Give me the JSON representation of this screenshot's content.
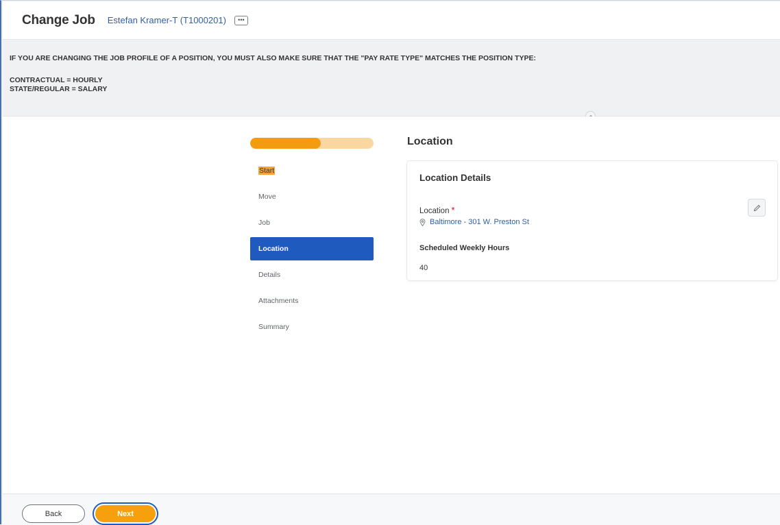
{
  "header": {
    "title": "Change Job",
    "worker": "Estefan Kramer-T (T1000201)",
    "related_actions_icon": "ellipsis-icon"
  },
  "notice": {
    "line1": "IF YOU ARE CHANGING THE JOB PROFILE OF A POSITION, YOU MUST ALSO MAKE SURE THAT THE \"PAY RATE TYPE\" MATCHES THE POSITION TYPE:",
    "line2": "CONTRACTUAL = HOURLY",
    "line3": "STATE/REGULAR = SALARY"
  },
  "progress": {
    "completed_fraction": 0.57
  },
  "steps": [
    {
      "label": "Start",
      "state": "highlighted"
    },
    {
      "label": "Move",
      "state": "default"
    },
    {
      "label": "Job",
      "state": "default"
    },
    {
      "label": "Location",
      "state": "active"
    },
    {
      "label": "Details",
      "state": "default"
    },
    {
      "label": "Attachments",
      "state": "default"
    },
    {
      "label": "Summary",
      "state": "default"
    }
  ],
  "section": {
    "title": "Location",
    "card_title": "Location Details",
    "location_label": "Location",
    "required_mark": "*",
    "location_value": "Baltimore - 301 W. Preston St",
    "hours_label": "Scheduled Weekly Hours",
    "hours_value": "40"
  },
  "footer": {
    "back_label": "Back",
    "next_label": "Next"
  },
  "colors": {
    "accent_orange": "#f39c12",
    "progress_track": "#fad7a1",
    "active_step": "#1f5bbf",
    "link_blue": "#2e5fa3",
    "required_red": "#d0021b"
  }
}
